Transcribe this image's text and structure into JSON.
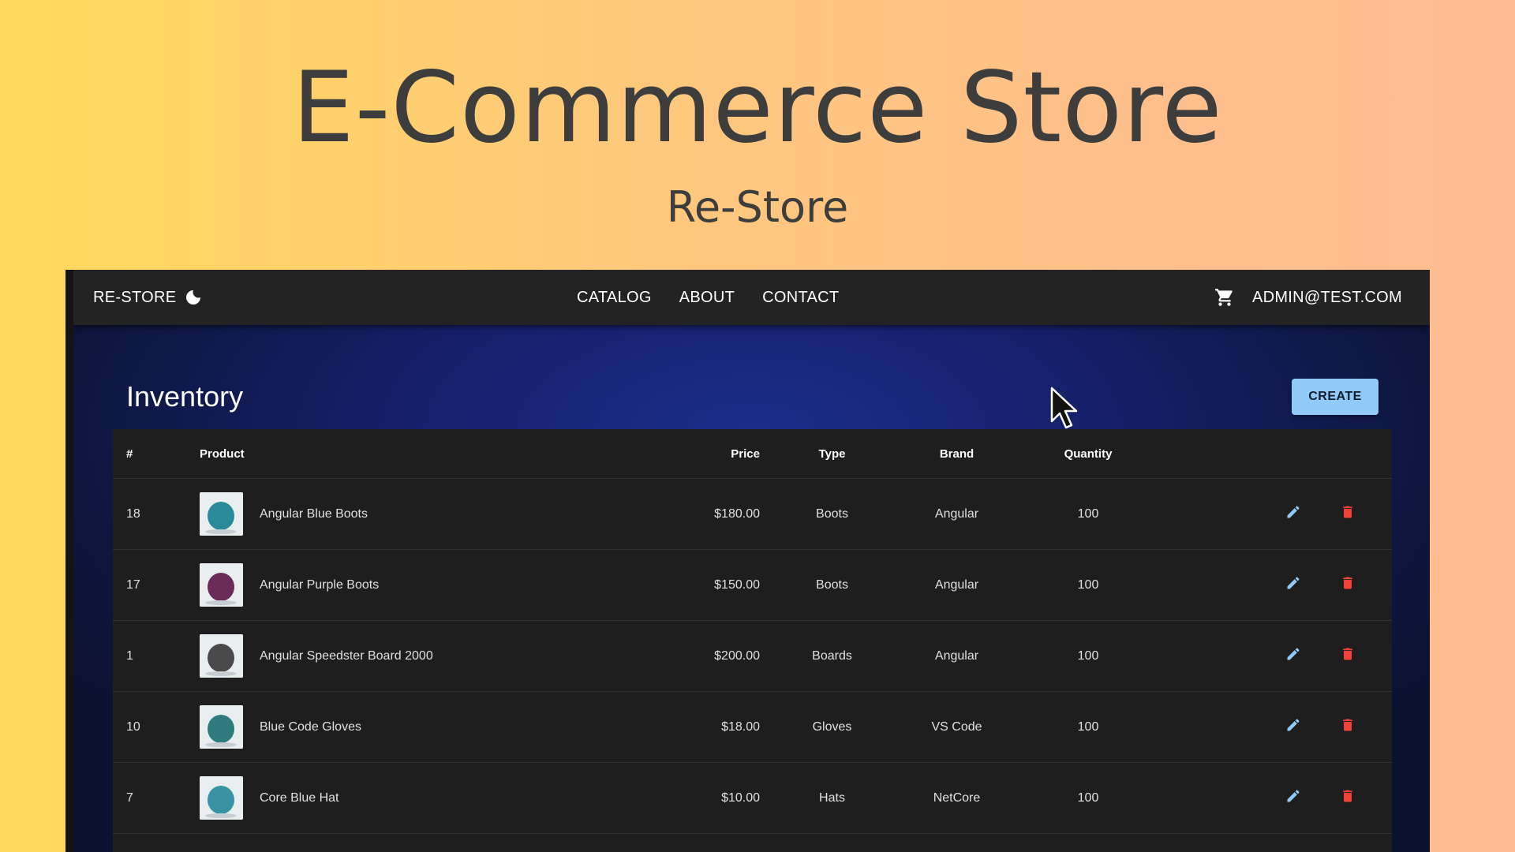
{
  "promo": {
    "title": "E-Commerce Store",
    "subtitle": "Re-Store"
  },
  "navbar": {
    "brand": "RE-STORE",
    "theme_icon": "moon-icon",
    "links": [
      "CATALOG",
      "ABOUT",
      "CONTACT"
    ],
    "cart_icon": "cart-icon",
    "user_email": "ADMIN@TEST.COM"
  },
  "inventory": {
    "heading": "Inventory",
    "create_label": "CREATE",
    "columns": {
      "id": "#",
      "product": "Product",
      "price": "Price",
      "type": "Type",
      "brand": "Brand",
      "quantity": "Quantity"
    },
    "rows": [
      {
        "id": "18",
        "name": "Angular Blue Boots",
        "price": "$180.00",
        "type": "Boots",
        "brand": "Angular",
        "quantity": "100",
        "thumb_color": "#2a8a9a"
      },
      {
        "id": "17",
        "name": "Angular Purple Boots",
        "price": "$150.00",
        "type": "Boots",
        "brand": "Angular",
        "quantity": "100",
        "thumb_color": "#6b2c5c"
      },
      {
        "id": "1",
        "name": "Angular Speedster Board 2000",
        "price": "$200.00",
        "type": "Boards",
        "brand": "Angular",
        "quantity": "100",
        "thumb_color": "#4a4a4a"
      },
      {
        "id": "10",
        "name": "Blue Code Gloves",
        "price": "$18.00",
        "type": "Gloves",
        "brand": "VS Code",
        "quantity": "100",
        "thumb_color": "#2f7c80"
      },
      {
        "id": "7",
        "name": "Core Blue Hat",
        "price": "$10.00",
        "type": "Hats",
        "brand": "NetCore",
        "quantity": "100",
        "thumb_color": "#3a93a3"
      }
    ],
    "edit_icon": "pencil-icon",
    "delete_icon": "trash-icon"
  },
  "colors": {
    "accent": "#90caf9",
    "edit": "#90caf9",
    "delete": "#f44336"
  }
}
